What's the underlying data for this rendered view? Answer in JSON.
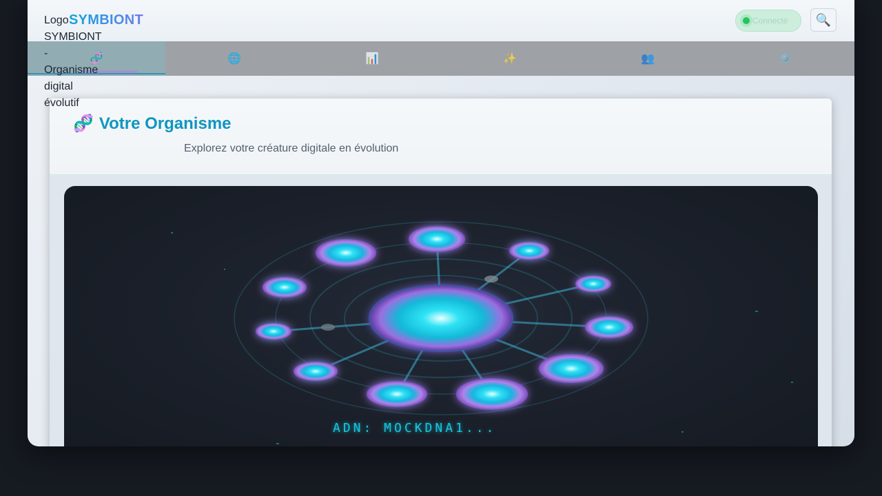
{
  "header": {
    "logo_alt": "Logo SYMBIONT - Organisme digital évolutif",
    "brand": "SYMBIONT",
    "status_label": "Connecté",
    "search_icon": "🔍"
  },
  "nav": {
    "items": [
      {
        "icon": "🧬",
        "name": "dna-icon",
        "active": true
      },
      {
        "icon": "🌐",
        "name": "globe-icon",
        "active": false
      },
      {
        "icon": "📊",
        "name": "bar-chart-icon",
        "active": false
      },
      {
        "icon": "✨",
        "name": "sparkles-icon",
        "active": false
      },
      {
        "icon": "👥",
        "name": "people-icon",
        "active": false
      },
      {
        "icon": "⚙️",
        "name": "gear-icon",
        "active": false
      }
    ]
  },
  "main": {
    "title_icon": "🧬",
    "title": "Votre Organisme",
    "subtitle": "Explorez votre créature digitale en évolution",
    "dna_label": "ADN: MOCKDNA1..."
  },
  "colors": {
    "accent": "#0f96bf",
    "brand_start": "#0ea5d9",
    "brand_end": "#6b7cf0",
    "status_green": "#22c55e",
    "node_cyan": "#14d8f0",
    "node_purple": "#b07ee0"
  }
}
